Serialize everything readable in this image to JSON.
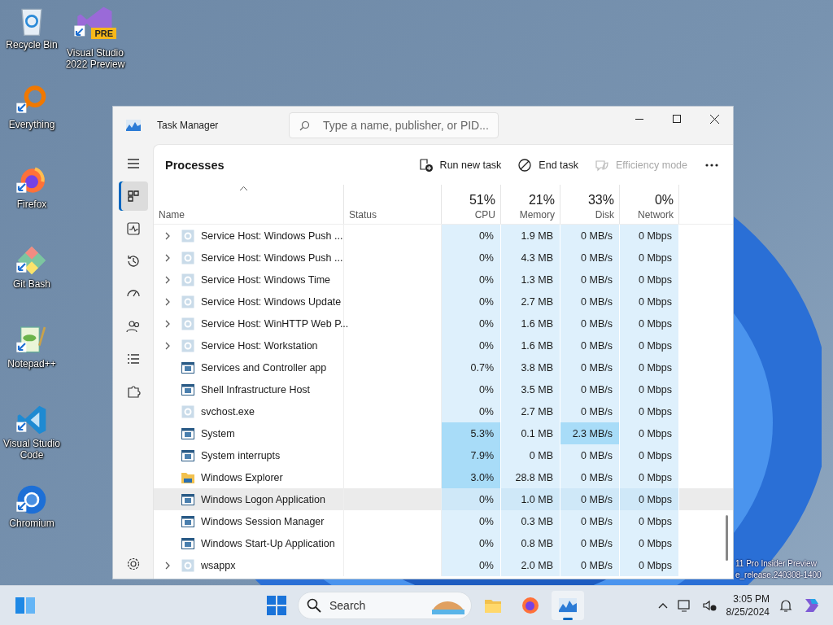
{
  "desktop": {
    "columns": [
      [
        {
          "kind": "recycle",
          "label": "Recycle Bin"
        },
        {
          "kind": "everything",
          "label": "Everything"
        },
        {
          "kind": "firefox",
          "label": "Firefox"
        },
        {
          "kind": "git",
          "label": "Git Bash"
        },
        {
          "kind": "notepad",
          "label": "Notepad++"
        },
        {
          "kind": "vscode",
          "label": "Visual Studio Code"
        },
        {
          "kind": "chromium",
          "label": "Chromium"
        }
      ],
      [
        {
          "kind": "vs",
          "label": "Visual Studio 2022 Preview",
          "badge": "PRE"
        }
      ]
    ],
    "edition_text": [
      "11 Pro Insider Preview",
      "e_release.240308-1400"
    ]
  },
  "window": {
    "title": "Task Manager",
    "search": {
      "placeholder": "Type a name, publisher, or PID..."
    },
    "nav": [
      {
        "kind": "menu",
        "selected": false
      },
      {
        "kind": "processes",
        "selected": true
      },
      {
        "kind": "performance",
        "selected": false
      },
      {
        "kind": "history",
        "selected": false
      },
      {
        "kind": "startup",
        "selected": false
      },
      {
        "kind": "users",
        "selected": false
      },
      {
        "kind": "details",
        "selected": false
      },
      {
        "kind": "services",
        "selected": false
      },
      {
        "kind": "settings",
        "selected": false
      }
    ],
    "page_title": "Processes",
    "toolbar": [
      {
        "kind": "run",
        "label": "Run new task",
        "disabled": false
      },
      {
        "kind": "end",
        "label": "End task",
        "disabled": false
      },
      {
        "kind": "efficiency",
        "label": "Efficiency mode",
        "disabled": true
      }
    ],
    "name_column": {
      "label": "Name"
    },
    "status_column": {
      "label": "Status"
    },
    "metric_columns": [
      {
        "total": "51%",
        "label": "CPU"
      },
      {
        "total": "21%",
        "label": "Memory"
      },
      {
        "total": "33%",
        "label": "Disk"
      },
      {
        "total": "0%",
        "label": "Network"
      }
    ],
    "rows": [
      {
        "name": "Service Host: Windows Push ...",
        "kind": "service",
        "expandable": true,
        "hovered": false,
        "cells": [
          {
            "text": "0%",
            "highlighted": false
          },
          {
            "text": "1.9 MB",
            "highlighted": false
          },
          {
            "text": "0 MB/s",
            "highlighted": false
          },
          {
            "text": "0 Mbps",
            "highlighted": false
          }
        ]
      },
      {
        "name": "Service Host: Windows Push ...",
        "kind": "service",
        "expandable": true,
        "hovered": false,
        "cells": [
          {
            "text": "0%",
            "highlighted": false
          },
          {
            "text": "4.3 MB",
            "highlighted": false
          },
          {
            "text": "0 MB/s",
            "highlighted": false
          },
          {
            "text": "0 Mbps",
            "highlighted": false
          }
        ]
      },
      {
        "name": "Service Host: Windows Time",
        "kind": "service",
        "expandable": true,
        "hovered": false,
        "cells": [
          {
            "text": "0%",
            "highlighted": false
          },
          {
            "text": "1.3 MB",
            "highlighted": false
          },
          {
            "text": "0 MB/s",
            "highlighted": false
          },
          {
            "text": "0 Mbps",
            "highlighted": false
          }
        ]
      },
      {
        "name": "Service Host: Windows Update",
        "kind": "service",
        "expandable": true,
        "hovered": false,
        "cells": [
          {
            "text": "0%",
            "highlighted": false
          },
          {
            "text": "2.7 MB",
            "highlighted": false
          },
          {
            "text": "0 MB/s",
            "highlighted": false
          },
          {
            "text": "0 Mbps",
            "highlighted": false
          }
        ]
      },
      {
        "name": "Service Host: WinHTTP Web P...",
        "kind": "service",
        "expandable": true,
        "hovered": false,
        "cells": [
          {
            "text": "0%",
            "highlighted": false
          },
          {
            "text": "1.6 MB",
            "highlighted": false
          },
          {
            "text": "0 MB/s",
            "highlighted": false
          },
          {
            "text": "0 Mbps",
            "highlighted": false
          }
        ]
      },
      {
        "name": "Service Host: Workstation",
        "kind": "service",
        "expandable": true,
        "hovered": false,
        "cells": [
          {
            "text": "0%",
            "highlighted": false
          },
          {
            "text": "1.6 MB",
            "highlighted": false
          },
          {
            "text": "0 MB/s",
            "highlighted": false
          },
          {
            "text": "0 Mbps",
            "highlighted": false
          }
        ]
      },
      {
        "name": "Services and Controller app",
        "kind": "app",
        "expandable": false,
        "hovered": false,
        "cells": [
          {
            "text": "0.7%",
            "highlighted": false
          },
          {
            "text": "3.8 MB",
            "highlighted": false
          },
          {
            "text": "0 MB/s",
            "highlighted": false
          },
          {
            "text": "0 Mbps",
            "highlighted": false
          }
        ]
      },
      {
        "name": "Shell Infrastructure Host",
        "kind": "app",
        "expandable": false,
        "hovered": false,
        "cells": [
          {
            "text": "0%",
            "highlighted": false
          },
          {
            "text": "3.5 MB",
            "highlighted": false
          },
          {
            "text": "0 MB/s",
            "highlighted": false
          },
          {
            "text": "0 Mbps",
            "highlighted": false
          }
        ]
      },
      {
        "name": "svchost.exe",
        "kind": "service",
        "expandable": false,
        "hovered": false,
        "cells": [
          {
            "text": "0%",
            "highlighted": false
          },
          {
            "text": "2.7 MB",
            "highlighted": false
          },
          {
            "text": "0 MB/s",
            "highlighted": false
          },
          {
            "text": "0 Mbps",
            "highlighted": false
          }
        ]
      },
      {
        "name": "System",
        "kind": "app",
        "expandable": false,
        "hovered": false,
        "cells": [
          {
            "text": "5.3%",
            "highlighted": true
          },
          {
            "text": "0.1 MB",
            "highlighted": false
          },
          {
            "text": "2.3 MB/s",
            "highlighted": true
          },
          {
            "text": "0 Mbps",
            "highlighted": false
          }
        ]
      },
      {
        "name": "System interrupts",
        "kind": "app",
        "expandable": false,
        "hovered": false,
        "cells": [
          {
            "text": "7.9%",
            "highlighted": true
          },
          {
            "text": "0 MB",
            "highlighted": false
          },
          {
            "text": "0 MB/s",
            "highlighted": false
          },
          {
            "text": "0 Mbps",
            "highlighted": false
          }
        ]
      },
      {
        "name": "Windows Explorer",
        "kind": "folder",
        "expandable": false,
        "hovered": false,
        "cells": [
          {
            "text": "3.0%",
            "highlighted": true
          },
          {
            "text": "28.8 MB",
            "highlighted": false
          },
          {
            "text": "0 MB/s",
            "highlighted": false
          },
          {
            "text": "0 Mbps",
            "highlighted": false
          }
        ]
      },
      {
        "name": "Windows Logon Application",
        "kind": "app",
        "expandable": false,
        "hovered": true,
        "cells": [
          {
            "text": "0%",
            "highlighted": false
          },
          {
            "text": "1.0 MB",
            "highlighted": false
          },
          {
            "text": "0 MB/s",
            "highlighted": false
          },
          {
            "text": "0 Mbps",
            "highlighted": false
          }
        ]
      },
      {
        "name": "Windows Session Manager",
        "kind": "app",
        "expandable": false,
        "hovered": false,
        "cells": [
          {
            "text": "0%",
            "highlighted": false
          },
          {
            "text": "0.3 MB",
            "highlighted": false
          },
          {
            "text": "0 MB/s",
            "highlighted": false
          },
          {
            "text": "0 Mbps",
            "highlighted": false
          }
        ]
      },
      {
        "name": "Windows Start-Up Application",
        "kind": "app",
        "expandable": false,
        "hovered": false,
        "cells": [
          {
            "text": "0%",
            "highlighted": false
          },
          {
            "text": "0.8 MB",
            "highlighted": false
          },
          {
            "text": "0 MB/s",
            "highlighted": false
          },
          {
            "text": "0 Mbps",
            "highlighted": false
          }
        ]
      },
      {
        "name": "wsappx",
        "kind": "service",
        "expandable": true,
        "hovered": false,
        "cells": [
          {
            "text": "0%",
            "highlighted": false
          },
          {
            "text": "2.0 MB",
            "highlighted": false
          },
          {
            "text": "0 MB/s",
            "highlighted": false
          },
          {
            "text": "0 Mbps",
            "highlighted": false
          }
        ]
      }
    ]
  },
  "taskbar": {
    "search": {
      "placeholder": "Search"
    },
    "apps": [
      {
        "kind": "explorer",
        "active": false
      },
      {
        "kind": "firefox",
        "active": false
      },
      {
        "kind": "taskmanager",
        "active": true
      }
    ],
    "time": "3:05 PM",
    "date": "8/25/2024"
  }
}
